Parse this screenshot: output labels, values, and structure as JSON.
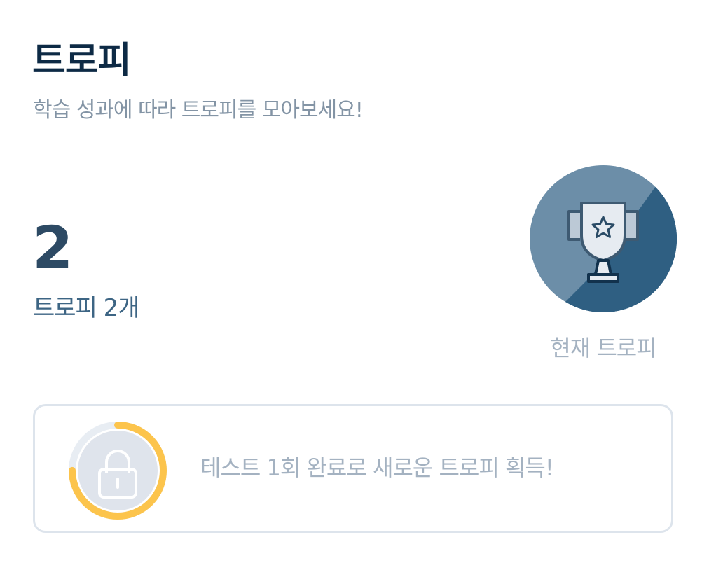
{
  "header": {
    "title": "트로피",
    "subtitle": "학습 성과에 따라 트로피를 모아보세요!"
  },
  "summary": {
    "count": "2",
    "count_label": "트로피 2개"
  },
  "current_trophy": {
    "icon": "trophy-star-icon",
    "label": "현재 트로피",
    "colors": {
      "light": "#6c8ea8",
      "dark": "#2f5f82"
    }
  },
  "next_trophy": {
    "icon": "lock-icon",
    "progress": 0.75,
    "progress_color": "#fcc44c",
    "text": "테스트 1회 완료로 새로운 트로피 획득!"
  }
}
